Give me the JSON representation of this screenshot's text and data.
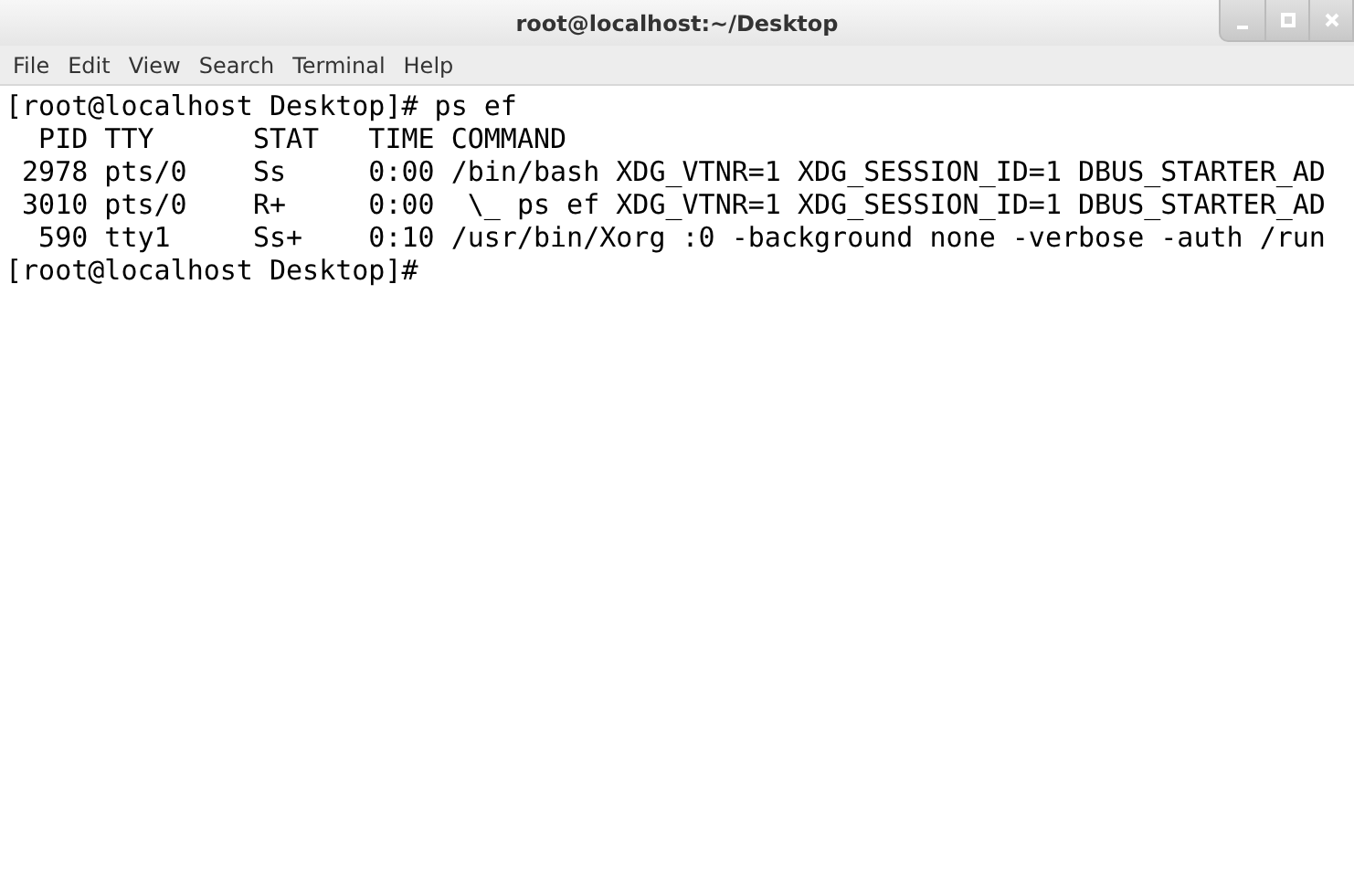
{
  "window": {
    "title": "root@localhost:~/Desktop"
  },
  "menu": [
    "File",
    "Edit",
    "View",
    "Search",
    "Terminal",
    "Help"
  ],
  "terminal": {
    "lines": [
      "[root@localhost Desktop]# ps ef",
      "  PID TTY      STAT   TIME COMMAND",
      " 2978 pts/0    Ss     0:00 /bin/bash XDG_VTNR=1 XDG_SESSION_ID=1 DBUS_STARTER_AD",
      " 3010 pts/0    R+     0:00  \\_ ps ef XDG_VTNR=1 XDG_SESSION_ID=1 DBUS_STARTER_AD",
      "  590 tty1     Ss+    0:10 /usr/bin/Xorg :0 -background none -verbose -auth /run",
      "[root@localhost Desktop]#"
    ]
  }
}
